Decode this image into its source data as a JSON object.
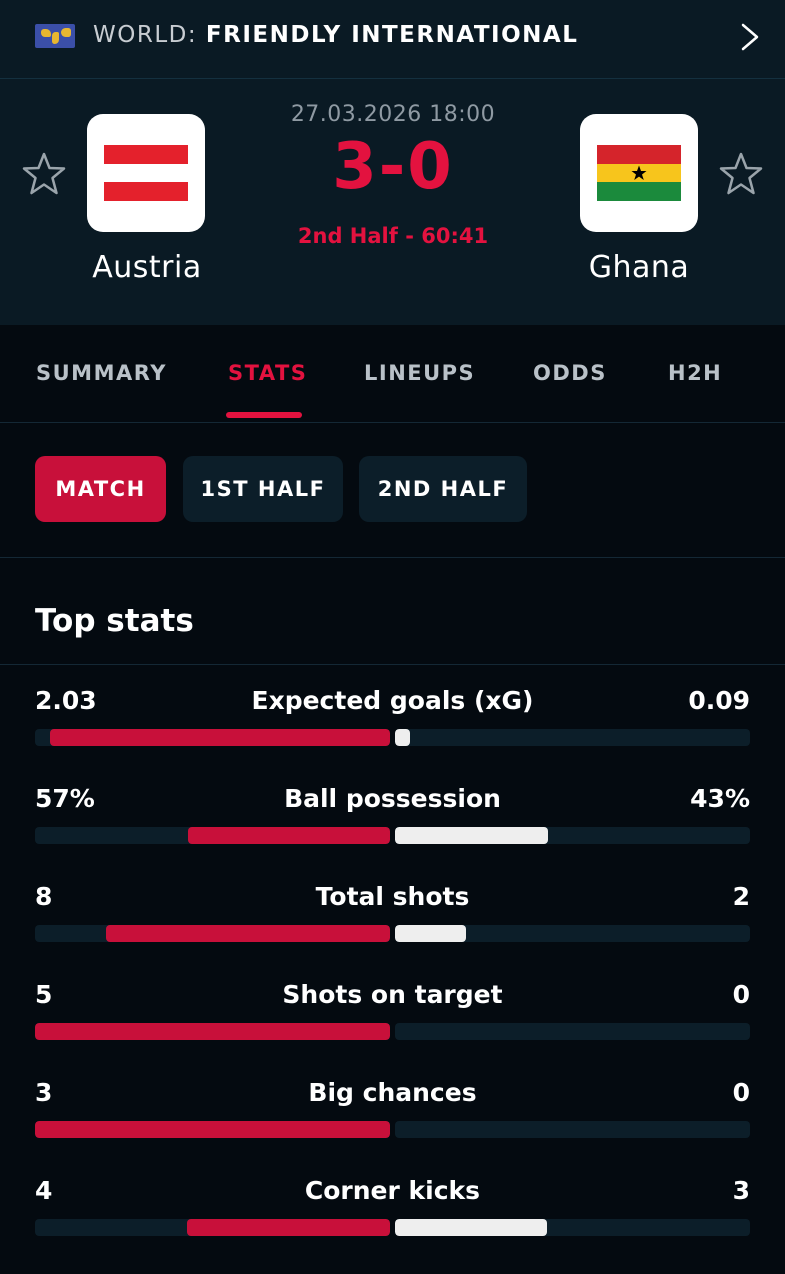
{
  "league": {
    "region": "WORLD: ",
    "name": "FRIENDLY INTERNATIONAL",
    "flag_icon": "world-map-flag-icon"
  },
  "match": {
    "datetime": "27.03.2026 18:00",
    "score": "3-0",
    "status": "2nd Half - 60:41",
    "home": {
      "name": "Austria",
      "flag": [
        "#e4212c",
        "#ffffff",
        "#e4212c"
      ]
    },
    "away": {
      "name": "Ghana",
      "flag": [
        "#d5242b",
        "#f7c51c",
        "#1b8a3c"
      ]
    }
  },
  "tabs": [
    {
      "label": "SUMMARY",
      "active": false
    },
    {
      "label": "STATS",
      "active": true
    },
    {
      "label": "LINEUPS",
      "active": false
    },
    {
      "label": "ODDS",
      "active": false
    },
    {
      "label": "H2H",
      "active": false
    }
  ],
  "period_tabs": [
    {
      "label": "MATCH",
      "active": true
    },
    {
      "label": "1ST HALF",
      "active": false
    },
    {
      "label": "2ND HALF",
      "active": false
    }
  ],
  "section_title": "Top stats",
  "stats": [
    {
      "label": "Expected goals (xG)",
      "home": "2.03",
      "away": "0.09",
      "home_share": 0.957,
      "away_share": 0.043
    },
    {
      "label": "Ball possession",
      "home": "57%",
      "away": "43%",
      "home_share": 0.57,
      "away_share": 0.43
    },
    {
      "label": "Total shots",
      "home": "8",
      "away": "2",
      "home_share": 0.8,
      "away_share": 0.2
    },
    {
      "label": "Shots on target",
      "home": "5",
      "away": "0",
      "home_share": 1.0,
      "away_share": 0.0
    },
    {
      "label": "Big chances",
      "home": "3",
      "away": "0",
      "home_share": 1.0,
      "away_share": 0.0
    },
    {
      "label": "Corner kicks",
      "home": "4",
      "away": "3",
      "home_share": 0.571,
      "away_share": 0.429
    }
  ],
  "colors": {
    "accent": "#e3123f",
    "home_bar": "#c8103a",
    "away_bar": "#eeeeee",
    "header_bg": "#0a1a24",
    "page_bg": "#040a10"
  }
}
